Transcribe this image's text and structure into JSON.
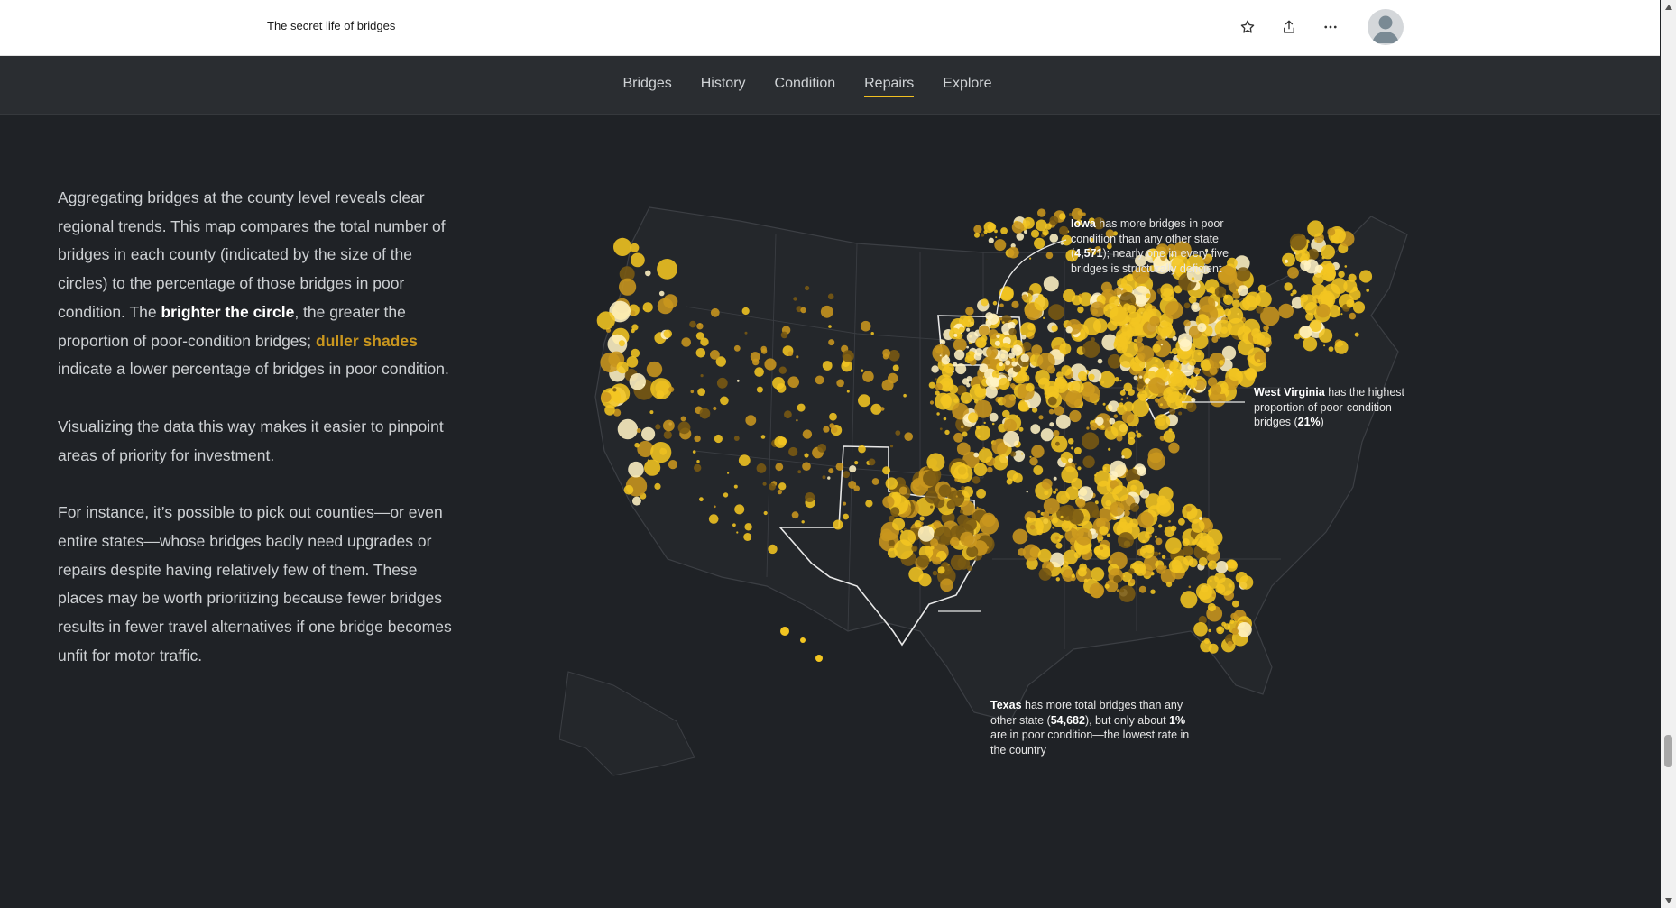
{
  "header": {
    "site_title": "The secret life of bridges",
    "actions": [
      {
        "name": "favorite",
        "icon": "star-icon"
      },
      {
        "name": "share",
        "icon": "share-icon"
      },
      {
        "name": "more",
        "icon": "more-horizontal-icon"
      }
    ],
    "avatar_icon": "user-avatar-icon"
  },
  "nav": {
    "items": [
      {
        "label": "Bridges",
        "active": false
      },
      {
        "label": "History",
        "active": false
      },
      {
        "label": "Condition",
        "active": false
      },
      {
        "label": "Repairs",
        "active": true
      },
      {
        "label": "Explore",
        "active": false
      }
    ],
    "active_color": "#f2c021"
  },
  "story": {
    "p1_a": "Aggregating bridges at the county level reveals clear regional trends. This map compares the total number of bridges in each county (indicated by the size of the circles) to the percentage of those bridges in poor condition. The ",
    "p1_bright": "brighter the circle",
    "p1_b": ", the greater the proportion of poor-condition bridges; ",
    "p1_dull": "duller shades",
    "p1_c": " indicate a lower percentage of bridges in poor condition.",
    "p2": "Visualizing the data this way makes it easier to pinpoint areas of priority for investment.",
    "p3": "For instance, it’s possible to pick out counties—or even entire states—whose bridges badly need upgrades or repairs despite having relatively few of them. These places may be worth prioritizing because fewer bridges results in fewer travel alternatives if one bridge becomes unfit for motor traffic."
  },
  "map": {
    "colors": {
      "bright": "#fff3c4",
      "high": "#f2c521",
      "mid": "#c9961e",
      "low": "#7a5a12",
      "state_line": "#4a4d52",
      "highlight": "#e8e8e8"
    },
    "annotations": {
      "iowa": {
        "state": "Iowa",
        "text_a": " has more bridges in poor condition than any other state (",
        "count": "4,571",
        "text_b": "); nearly one in every five bridges is structurally deficient"
      },
      "west_virginia": {
        "state": "West Virginia",
        "text_a": " has the highest proportion of poor-condition bridges (",
        "pct": "21%",
        "text_b": ")"
      },
      "texas": {
        "state": "Texas",
        "text_a": " has more total bridges than any other state (",
        "count": "54,682",
        "text_b": "), but only about ",
        "pct": "1%",
        "text_c": " are in poor condition—the lowest rate in the country"
      }
    }
  },
  "scrollbar": {
    "up_icon": "scroll-up-icon",
    "down_icon": "scroll-down-icon"
  }
}
